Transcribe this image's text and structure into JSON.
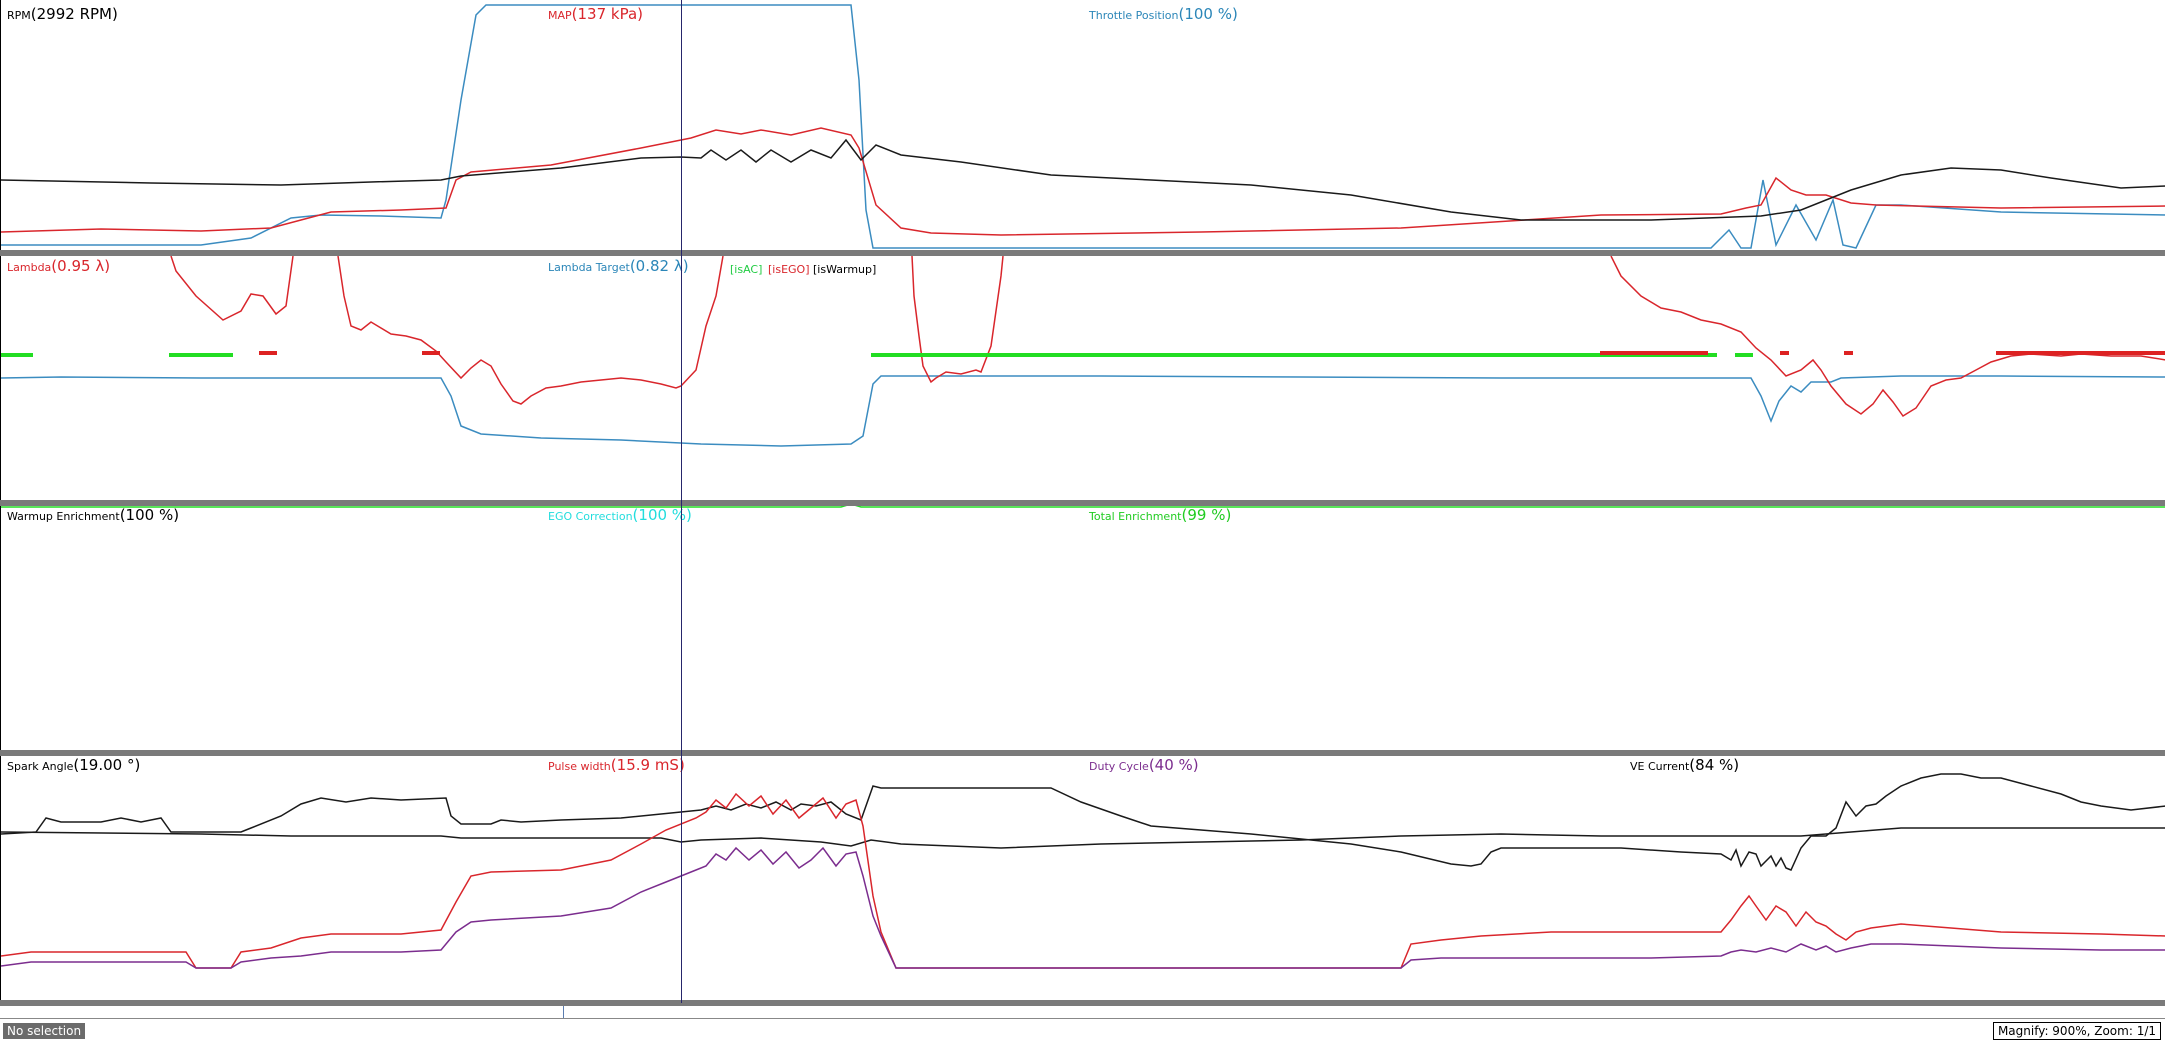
{
  "panels": [
    {
      "labels": [
        {
          "name": "RPM",
          "value": "(2992 RPM)",
          "color": "#000000"
        },
        {
          "name": "MAP",
          "value": "(137 kPa)",
          "color": "#d9262c"
        },
        {
          "name": "Throttle Position",
          "value": "(100 %)",
          "color": "#2b86b8"
        }
      ]
    },
    {
      "labels": [
        {
          "name": "Lambda",
          "value": "(0.95 λ)",
          "color": "#d9262c"
        },
        {
          "name": "Lambda Target",
          "value": "(0.82 λ)",
          "color": "#2b86b8"
        }
      ],
      "flags": [
        {
          "text": "[isAC]",
          "color": "#22cc44"
        },
        {
          "text": "[isEGO]",
          "color": "#d9262c"
        },
        {
          "text": "[isWarmup]",
          "color": "#000000"
        }
      ]
    },
    {
      "labels": [
        {
          "name": "Warmup Enrichment",
          "value": "(100 %)",
          "color": "#000000"
        },
        {
          "name": "EGO Correction",
          "value": "(100 %)",
          "color": "#22dddd"
        },
        {
          "name": "Total Enrichment",
          "value": "(99 %)",
          "color": "#22cc22"
        }
      ]
    },
    {
      "labels": [
        {
          "name": "Spark Angle",
          "value": "(19.00 °)",
          "color": "#000000"
        },
        {
          "name": "Pulse width",
          "value": "(15.9 mS)",
          "color": "#d9262c"
        },
        {
          "name": "Duty Cycle",
          "value": "(40 %)",
          "color": "#7b2d8e"
        },
        {
          "name": "VE Current",
          "value": "(84 %)",
          "color": "#000000"
        }
      ]
    }
  ],
  "status": {
    "selection": "No selection",
    "zoom": "Magnify: 900%, Zoom: 1/1"
  },
  "colors": {
    "black": "#1a1a1a",
    "red": "#d9262c",
    "blue": "#3b8cc0",
    "green": "#22dd22",
    "purple": "#7b2d8e",
    "cursor": "#26266b"
  }
}
